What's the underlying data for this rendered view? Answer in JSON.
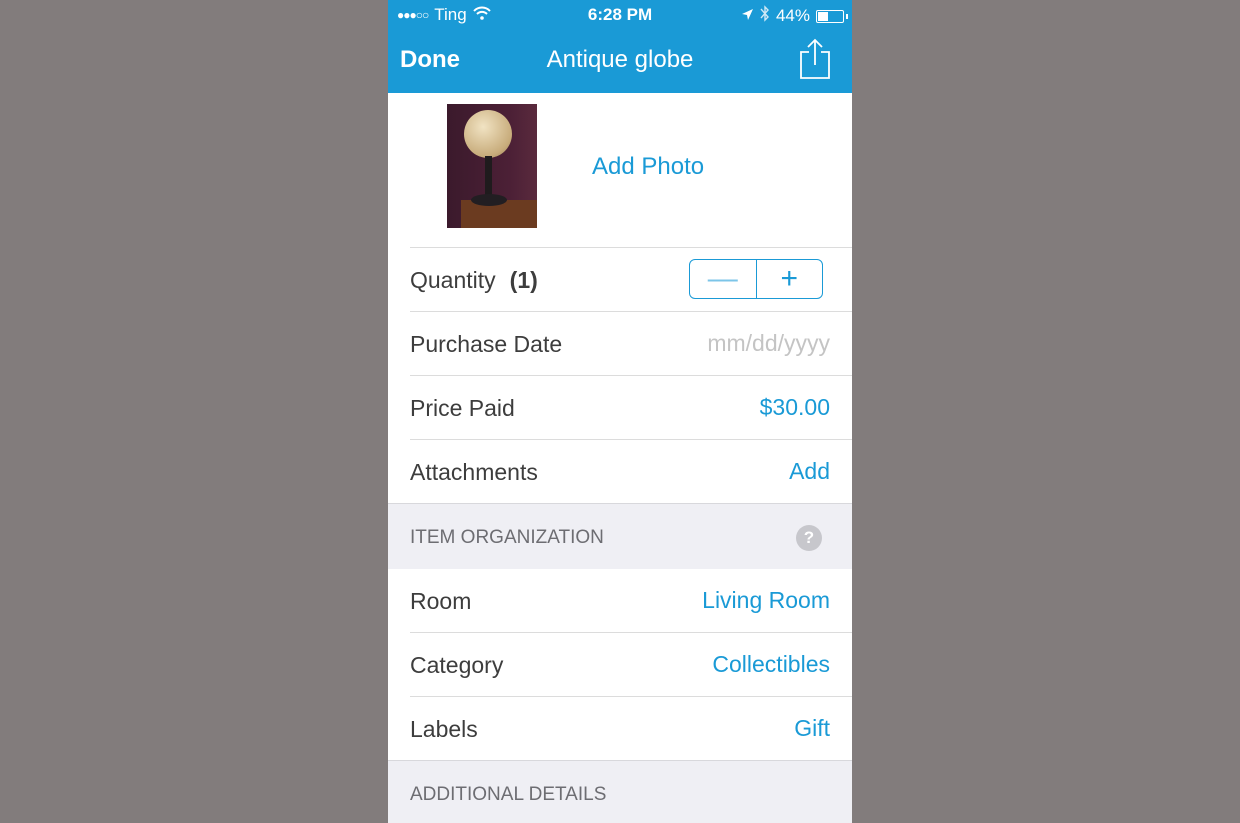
{
  "status_bar": {
    "signal": "●●●○○",
    "carrier": "Ting",
    "wifi_icon": "wifi-icon",
    "time": "6:28 PM",
    "location_icon": "location-arrow-icon",
    "bluetooth_icon": "bluetooth-icon",
    "battery_percent": "44%",
    "battery_level": 0.44
  },
  "nav": {
    "done_label": "Done",
    "title": "Antique globe",
    "share_icon": "share-icon"
  },
  "photo": {
    "add_photo_label": "Add Photo"
  },
  "details": {
    "quantity": {
      "label": "Quantity",
      "count": "(1)",
      "minus": "—",
      "plus": "+"
    },
    "purchase_date": {
      "label": "Purchase Date",
      "placeholder": "mm/dd/yyyy"
    },
    "price_paid": {
      "label": "Price Paid",
      "value": "$30.00"
    },
    "attachments": {
      "label": "Attachments",
      "value": "Add"
    }
  },
  "item_organization": {
    "header": "ITEM ORGANIZATION",
    "help": "?",
    "room": {
      "label": "Room",
      "value": "Living Room"
    },
    "category": {
      "label": "Category",
      "value": "Collectibles"
    },
    "labels": {
      "label": "Labels",
      "value": "Gift"
    }
  },
  "additional_details": {
    "header": "ADDITIONAL DETAILS"
  },
  "colors": {
    "accent": "#1a9ad6",
    "section_bg": "#efeff4",
    "outer_bg": "#827c7c"
  }
}
